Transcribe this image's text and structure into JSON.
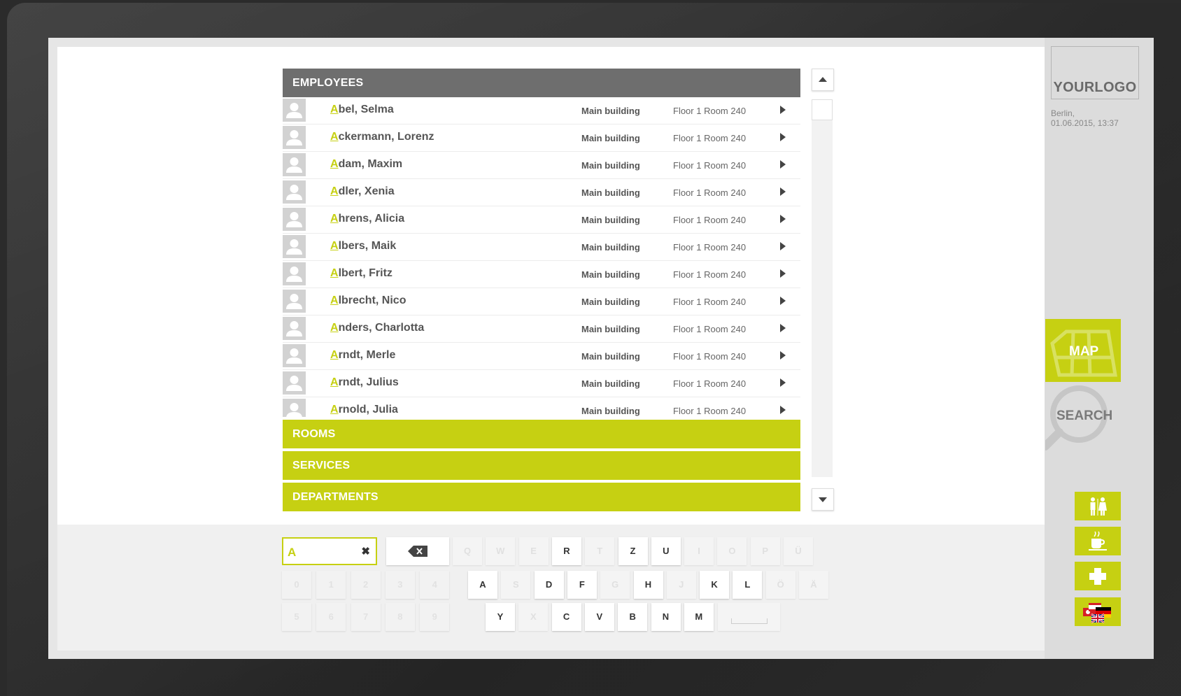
{
  "logo": "YOURLOGO",
  "location": {
    "city": "Berlin,",
    "datetime": "01.06.2015, 13:37"
  },
  "categories": {
    "employees": "EMPLOYEES",
    "rooms": "ROOMS",
    "services": "SERVICES",
    "departments": "DEPARTMENTS"
  },
  "employees": [
    {
      "first": "A",
      "rest": "bel, Selma",
      "building": "Main building",
      "room": "Floor 1 Room 240"
    },
    {
      "first": "A",
      "rest": "ckermann, Lorenz",
      "building": "Main building",
      "room": "Floor 1 Room 240"
    },
    {
      "first": "A",
      "rest": "dam, Maxim",
      "building": "Main building",
      "room": "Floor 1 Room 240"
    },
    {
      "first": "A",
      "rest": "dler, Xenia",
      "building": "Main building",
      "room": "Floor 1 Room 240"
    },
    {
      "first": "A",
      "rest": "hrens, Alicia",
      "building": "Main building",
      "room": "Floor 1 Room 240"
    },
    {
      "first": "A",
      "rest": "lbers, Maik",
      "building": "Main building",
      "room": "Floor 1 Room 240"
    },
    {
      "first": "A",
      "rest": "lbert, Fritz",
      "building": "Main building",
      "room": "Floor 1 Room 240"
    },
    {
      "first": "A",
      "rest": "lbrecht, Nico",
      "building": "Main building",
      "room": "Floor 1 Room 240"
    },
    {
      "first": "A",
      "rest": "nders, Charlotta",
      "building": "Main building",
      "room": "Floor 1 Room 240"
    },
    {
      "first": "A",
      "rest": "rndt, Merle",
      "building": "Main building",
      "room": "Floor 1 Room 240"
    },
    {
      "first": "A",
      "rest": "rndt, Julius",
      "building": "Main building",
      "room": "Floor 1 Room 240"
    },
    {
      "first": "A",
      "rest": "rnold, Julia",
      "building": "Main building",
      "room": "Floor 1 Room 240"
    }
  ],
  "search": {
    "value": "A"
  },
  "keyboard": {
    "row1": [
      {
        "k": "Q",
        "on": false
      },
      {
        "k": "W",
        "on": false
      },
      {
        "k": "E",
        "on": false
      },
      {
        "k": "R",
        "on": true
      },
      {
        "k": "T",
        "on": false
      },
      {
        "k": "Z",
        "on": true
      },
      {
        "k": "U",
        "on": true
      },
      {
        "k": "I",
        "on": false
      },
      {
        "k": "O",
        "on": false
      },
      {
        "k": "P",
        "on": false
      },
      {
        "k": "Ü",
        "on": false
      }
    ],
    "row2": [
      {
        "k": "A",
        "on": true
      },
      {
        "k": "S",
        "on": false
      },
      {
        "k": "D",
        "on": true
      },
      {
        "k": "F",
        "on": true
      },
      {
        "k": "G",
        "on": false
      },
      {
        "k": "H",
        "on": true
      },
      {
        "k": "J",
        "on": false
      },
      {
        "k": "K",
        "on": true
      },
      {
        "k": "L",
        "on": true
      },
      {
        "k": "Ö",
        "on": false
      },
      {
        "k": "Ä",
        "on": false
      }
    ],
    "row3": [
      {
        "k": "Y",
        "on": true
      },
      {
        "k": "X",
        "on": false
      },
      {
        "k": "C",
        "on": true
      },
      {
        "k": "V",
        "on": true
      },
      {
        "k": "B",
        "on": true
      },
      {
        "k": "N",
        "on": true
      },
      {
        "k": "M",
        "on": true
      }
    ],
    "numbers_row1": [
      "0",
      "1",
      "2",
      "3",
      "4"
    ],
    "numbers_row2": [
      "5",
      "6",
      "7",
      "8",
      "9"
    ]
  },
  "nav": {
    "map": "MAP",
    "search": "SEARCH"
  },
  "icons": [
    "restroom-icon",
    "cafe-icon",
    "first-aid-icon",
    "language-flags-icon"
  ],
  "colors": {
    "accent": "#c6d012",
    "header": "#6e6e6e"
  }
}
